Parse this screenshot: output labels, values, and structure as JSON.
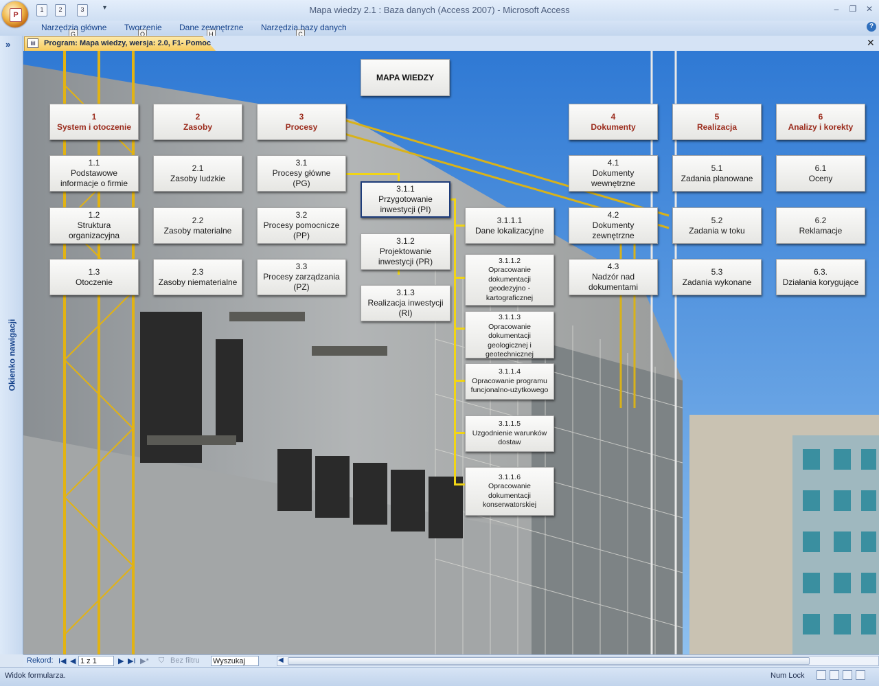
{
  "window": {
    "title": "Mapa wiedzy 2.1 : Baza danych (Access 2007)  -  Microsoft Access",
    "minimize": "–",
    "restore": "❐",
    "close": "✕"
  },
  "qat": {
    "office_button_letter": "P",
    "keytips": [
      "1",
      "2",
      "3"
    ],
    "more": "▾"
  },
  "ribbon": {
    "tabs": [
      {
        "label": "Narzędzia główne",
        "keytip": "G"
      },
      {
        "label": "Tworzenie",
        "keytip": "O"
      },
      {
        "label": "Dane zewnętrzne",
        "keytip": "H"
      },
      {
        "label": "Narzędzia bazy danych",
        "keytip": "C"
      }
    ],
    "help": "?"
  },
  "nav_pane": {
    "toggle": "»",
    "label": "Okienko nawigacji"
  },
  "document_tab": {
    "label": "Program: Mapa wiedzy, wersja: 2.0, F1- Pomoc",
    "close": "✕"
  },
  "map": {
    "title": "MAPA WIEDZY",
    "sections": [
      {
        "label": "1\nSystem i otoczenie",
        "items": [
          "1.1\nPodstawowe\ninformacje o firmie",
          "1.2\nStruktura\norganizacyjna",
          "1.3\nOtoczenie"
        ]
      },
      {
        "label": "2\nZasoby",
        "items": [
          "2.1\nZasoby ludzkie",
          "2.2\nZasoby materialne",
          "2.3\nZasoby niematerialne"
        ]
      },
      {
        "label": "3\nProcesy",
        "items": [
          "3.1\nProcesy główne\n(PG)",
          "3.2\nProcesy pomocnicze\n(PP)",
          "3.3\nProcesy zarządzania\n(PZ)"
        ]
      },
      {
        "label": "4\nDokumenty",
        "items": [
          "4.1\nDokumenty\nwewnętrzne",
          "4.2\nDokumenty\nzewnętrzne",
          "4.3\nNadzór nad\ndokumentami"
        ]
      },
      {
        "label": "5\nRealizacja",
        "items": [
          "5.1\nZadania planowane",
          "5.2\nZadania w toku",
          "5.3\nZadania wykonane"
        ]
      },
      {
        "label": "6\nAnalizy i korekty",
        "items": [
          "6.1\nOceny",
          "6.2\nReklamacje",
          "6.3.\nDziałania korygujące"
        ]
      }
    ],
    "sub_processes": [
      "3.1.1\nPrzygotowanie\ninwestycji (PI)",
      "3.1.2\nProjektowanie\ninwestycji (PR)",
      "3.1.3\nRealizacja inwestycji\n(RI)"
    ],
    "sub_sub_processes": [
      "3.1.1.1\nDane lokalizacyjne",
      "3.1.1.2\nOpracowanie\ndokumentacji\ngeodezyjno -\nkartograficznej",
      "3.1.1.3\nOpracowanie\ndokumentacji\ngeologicznej i\ngeotechnicznej",
      "3.1.1.4\nOpracowanie programu\nfuncjonalno-użytkowego",
      "3.1.1.5\nUzgodnienie warunków\ndostaw",
      "3.1.1.6\nOpracowanie\ndokumentacji\nkonserwatorskiej"
    ]
  },
  "record_nav": {
    "label": "Rekord:",
    "first": "I◀",
    "prev": "◀",
    "current": "1 z 1",
    "next": "▶",
    "last": "▶I",
    "new": "▶*",
    "filter": "Bez filtru",
    "search": "Wyszukaj",
    "scroll_left": "◀"
  },
  "status": {
    "text": "Widok formularza.",
    "numlock": "Num Lock"
  },
  "colors": {
    "sky": "#3f86d8",
    "header_text": "#9b2b1c",
    "connector": "#f1d516"
  }
}
